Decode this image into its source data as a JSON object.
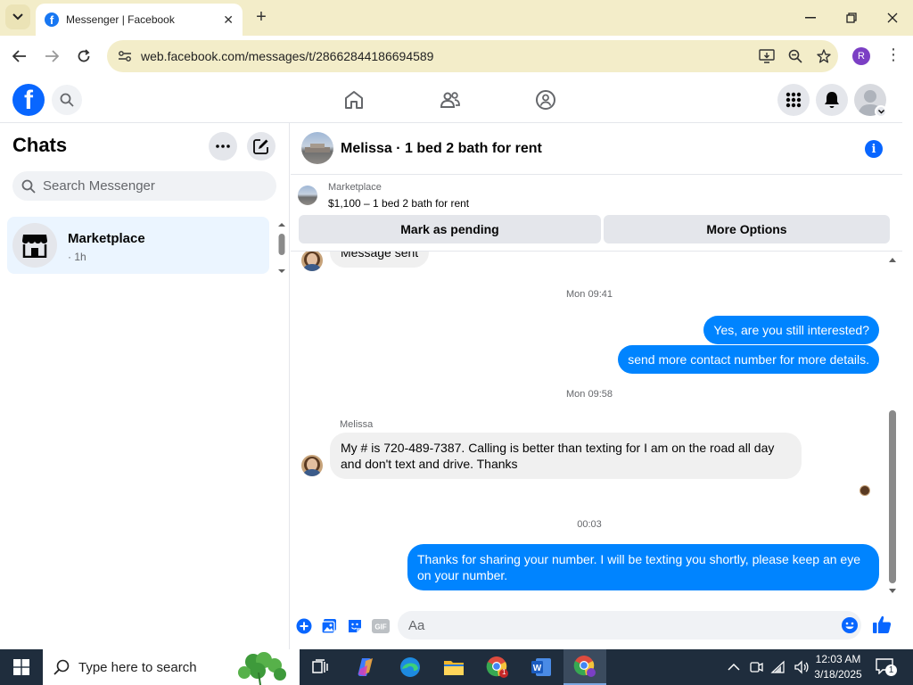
{
  "browser": {
    "tab_title": "Messenger | Facebook",
    "url": "web.facebook.com/messages/t/28662844186694589",
    "profile_initial": "R"
  },
  "sidebar": {
    "title": "Chats",
    "search_placeholder": "Search Messenger",
    "chats": [
      {
        "name": "Marketplace",
        "time": "· 1h"
      }
    ]
  },
  "conversation": {
    "title": "Melissa · 1 bed 2 bath for rent",
    "listing": {
      "label": "Marketplace",
      "description": "$1,100 – 1 bed 2 bath for rent",
      "mark_pending_label": "Mark as pending",
      "more_options_label": "More Options"
    },
    "messages": {
      "partial_in": "Message sent",
      "ts1": "Mon 09:41",
      "out1": "Yes, are you still interested?",
      "out2": "send more contact number for more details.",
      "ts2": "Mon 09:58",
      "sender": "Melissa",
      "in1": "My # is 720-489-7387. Calling is better than texting for I am on the road all day and don't text and drive. Thanks",
      "ts3": "00:03",
      "out3": "Thanks for sharing your number. I will be texting you shortly, please keep an eye on your number."
    },
    "composer_placeholder": "Aa"
  },
  "taskbar": {
    "search_placeholder": "Type here to search",
    "time": "12:03 AM",
    "date": "3/18/2025",
    "notification_count": "1",
    "chrome_badge": "1"
  },
  "colors": {
    "facebook_blue": "#0866ff",
    "bubble_out": "#0084ff",
    "bubble_in": "#f0f0f0",
    "tab_bar": "#f3edc9",
    "taskbar": "#1f2d3d"
  }
}
